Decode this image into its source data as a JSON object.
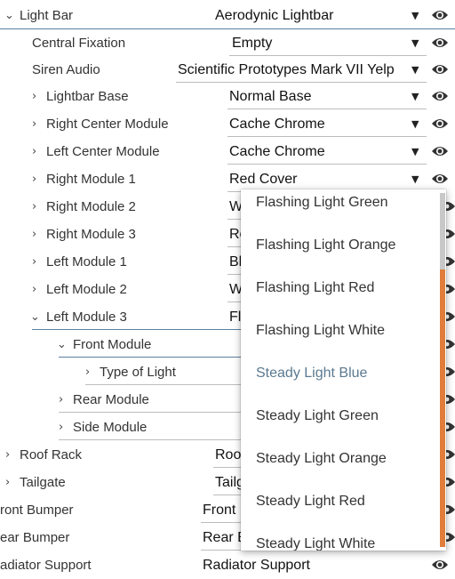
{
  "rows": [
    {
      "label": "Light Bar",
      "value": "Aerodynic Lightbar"
    },
    {
      "label": "Central Fixation",
      "value": "Empty"
    },
    {
      "label": "Siren Audio",
      "value": "Scientific Prototypes Mark VII Yelp"
    },
    {
      "label": "Lightbar Base",
      "value": "Normal Base"
    },
    {
      "label": "Right Center Module",
      "value": "Cache Chrome"
    },
    {
      "label": "Left Center Module",
      "value": "Cache Chrome"
    },
    {
      "label": "Right Module 1",
      "value": "Red Cover"
    },
    {
      "label": "Right Module 2",
      "value": "W"
    },
    {
      "label": "Right Module 3",
      "value": "Re"
    },
    {
      "label": "Left Module 1",
      "value": "Bl"
    },
    {
      "label": "Left Module 2",
      "value": "W"
    },
    {
      "label": "Left Module 3",
      "value": "Fl"
    },
    {
      "label": "Front Module",
      "value": ""
    },
    {
      "label": "Type of Light",
      "value": ""
    },
    {
      "label": "Rear Module",
      "value": ""
    },
    {
      "label": "Side Module",
      "value": ""
    },
    {
      "label": "Roof Rack",
      "value": "Roo"
    },
    {
      "label": "Tailgate",
      "value": "Tailg"
    },
    {
      "label": "ront Bumper",
      "value": "Front I"
    },
    {
      "label": "ear Bumper",
      "value": "Rear B"
    },
    {
      "label": "adiator Support",
      "value": "Radiator Support"
    }
  ],
  "dropdown": {
    "options": [
      "Flashing Light Green",
      "Flashing Light Orange",
      "Flashing Light Red",
      "Flashing Light White",
      "Steady Light Blue",
      "Steady Light Green",
      "Steady Light Orange",
      "Steady Light Red",
      "Steady Light White"
    ],
    "selected": "Steady Light Blue"
  },
  "colors": {
    "accent": "#e07d3a",
    "selected_text": "#5b7a90",
    "underline_active": "#5b7fa0"
  },
  "icons": {
    "expand": "chevron-right-icon",
    "collapse": "chevron-down-icon",
    "visibility": "eye-icon",
    "dropdown": "caret-down-icon"
  }
}
